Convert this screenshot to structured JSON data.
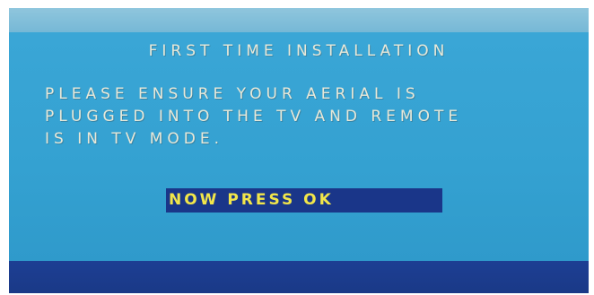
{
  "screen": {
    "title": "FIRST TIME INSTALLATION",
    "message_lines": [
      "PLEASE ENSURE YOUR AERIAL IS",
      "PLUGGED INTO THE TV AND REMOTE",
      "IS IN TV MODE."
    ],
    "ok_button_label": "NOW PRESS OK"
  },
  "colors": {
    "background": "#36a4d3",
    "top_strip": "#8fc6dd",
    "bottom_bar": "#1d3f93",
    "text": "#e8e8d8",
    "button_background": "#1a3689",
    "button_text": "#f2e64a"
  }
}
